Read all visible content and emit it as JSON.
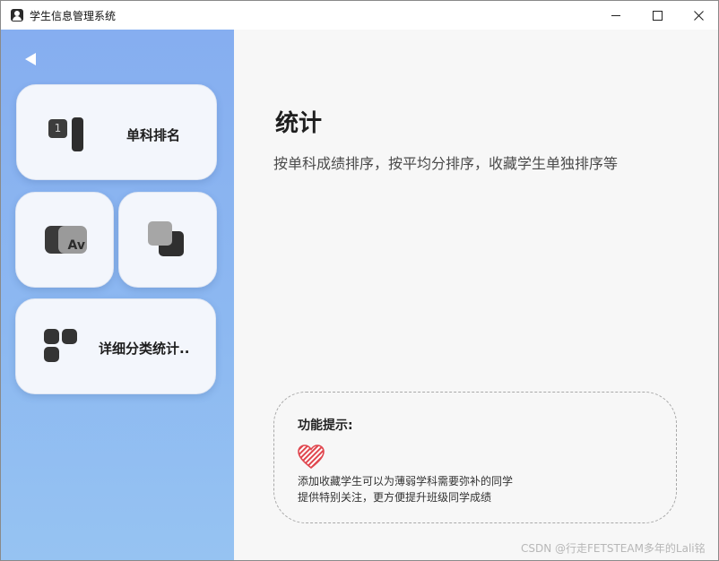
{
  "window": {
    "title": "学生信息管理系统",
    "minimize_icon": "minimize-icon",
    "maximize_icon": "maximize-icon",
    "close_icon": "close-icon"
  },
  "sidebar": {
    "back_icon": "back-arrow-icon",
    "cards": [
      {
        "id": "rank",
        "label": "单科排名",
        "icon": "ranking-icon"
      },
      {
        "id": "av",
        "label": "",
        "icon": "av-font-icon"
      },
      {
        "id": "copy",
        "label": "",
        "icon": "copy-paste-icon"
      },
      {
        "id": "detail",
        "label": "详细分类统计..",
        "icon": "blocks-icon"
      }
    ]
  },
  "main": {
    "title": "统计",
    "subtitle": "按单科成绩排序，按平均分排序，收藏学生单独排序等",
    "tip": {
      "title": "功能提示:",
      "icon": "heart-icon",
      "line1": "添加收藏学生可以为薄弱学科需要弥补的同学",
      "line2": "提供特别关注，更方便提升班级同学成绩"
    },
    "watermark": "CSDN @行走FETSTEAM多年的Lali铭"
  },
  "colors": {
    "sidebar_top": "#86aef0",
    "sidebar_bottom": "#96c3f2",
    "card_bg": "#f3f6fc",
    "heart": "#e0464e"
  }
}
